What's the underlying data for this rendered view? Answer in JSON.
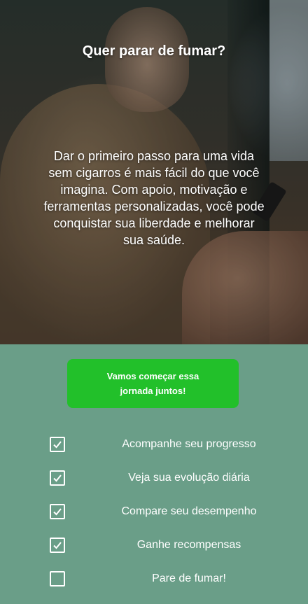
{
  "hero": {
    "title": "Quer parar de fumar?",
    "text": "Dar o primeiro passo para uma vida sem cigarros é mais fácil do que você imagina. Com apoio, motivação e ferramentas personalizadas, você pode conquistar sua liberdade e melhorar sua saúde."
  },
  "cta": {
    "label": "Vamos começar essa jornada juntos!",
    "color": "#22c02a"
  },
  "features": [
    {
      "label": "Acompanhe seu progresso",
      "checked": true,
      "icon": "checked-checkbox-icon"
    },
    {
      "label": "Veja sua evolução diária",
      "checked": true,
      "icon": "checked-checkbox-icon"
    },
    {
      "label": "Compare seu desempenho",
      "checked": true,
      "icon": "checked-checkbox-icon"
    },
    {
      "label": "Ganhe recompensas",
      "checked": true,
      "icon": "checked-checkbox-icon"
    },
    {
      "label": "Pare de fumar!",
      "checked": false,
      "icon": "empty-checkbox-icon"
    }
  ],
  "colors": {
    "background": "#6a9e88",
    "text": "#ffffff"
  }
}
